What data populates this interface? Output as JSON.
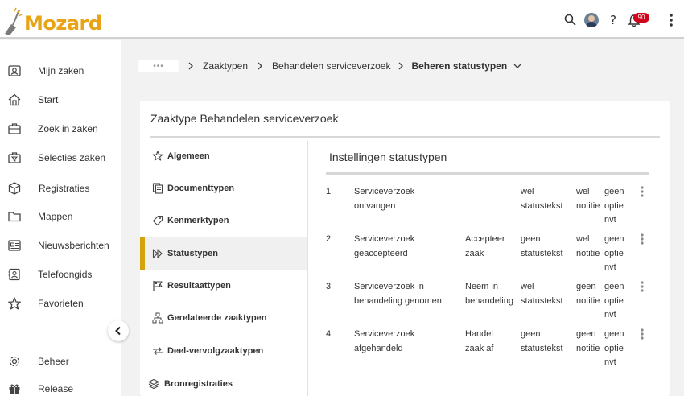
{
  "app": {
    "logo_text": "Mozard"
  },
  "topbar": {
    "notification_count": "90"
  },
  "sidebar": {
    "items": [
      {
        "label": "Mijn zaken",
        "icon": "user-card-icon"
      },
      {
        "label": "Start",
        "icon": "home-icon"
      },
      {
        "label": "Zoek in zaken",
        "icon": "briefcase-search-icon"
      },
      {
        "label": "Selecties zaken",
        "icon": "briefcase-filter-icon"
      },
      {
        "label": "Registraties",
        "icon": "cube-icon"
      },
      {
        "label": "Mappen",
        "icon": "folder-icon"
      },
      {
        "label": "Nieuwsberichten",
        "icon": "newspaper-icon"
      },
      {
        "label": "Telefoongids",
        "icon": "contacts-icon"
      },
      {
        "label": "Favorieten",
        "icon": "star-icon"
      },
      {
        "label": "Beheer",
        "icon": "gear-icon"
      },
      {
        "label": "Release",
        "icon": "gift-icon"
      }
    ]
  },
  "breadcrumb": {
    "dots": "•••",
    "items": [
      "Zaaktypen",
      "Behandelen serviceverzoek"
    ],
    "current": "Beheren statustypen"
  },
  "card": {
    "title": "Zaaktype Behandelen serviceverzoek"
  },
  "nav": {
    "items": [
      {
        "label": "Algemeen",
        "icon": "star-outline-icon"
      },
      {
        "label": "Documenttypen",
        "icon": "documents-icon"
      },
      {
        "label": "Kenmerktypen",
        "icon": "tag-icon"
      },
      {
        "label": "Statustypen",
        "icon": "step-forward-icon",
        "active": true
      },
      {
        "label": "Resultaattypen",
        "icon": "flag-icon"
      },
      {
        "label": "Gerelateerde zaaktypen",
        "icon": "hierarchy-icon"
      },
      {
        "label": "Deel-vervolgzaaktypen",
        "icon": "arrows-icon"
      },
      {
        "label": "Bronregistraties",
        "icon": "layers-icon"
      }
    ]
  },
  "section": {
    "title": "Instellingen statustypen",
    "rows": [
      {
        "num": "1",
        "name": [
          "Serviceverzoek",
          "ontvangen"
        ],
        "action": [
          "",
          ""
        ],
        "status": [
          "wel",
          "statustekst"
        ],
        "notitie": [
          "wel",
          "notitie"
        ],
        "optie": [
          "geen",
          "optie",
          "nvt"
        ]
      },
      {
        "num": "2",
        "name": [
          "Serviceverzoek",
          "geaccepteerd"
        ],
        "action": [
          "Accepteer",
          "zaak"
        ],
        "status": [
          "geen",
          "statustekst"
        ],
        "notitie": [
          "wel",
          "notitie"
        ],
        "optie": [
          "geen",
          "optie",
          "nvt"
        ]
      },
      {
        "num": "3",
        "name": [
          "Serviceverzoek in",
          "behandeling genomen"
        ],
        "action": [
          "Neem in",
          "behandeling"
        ],
        "status": [
          "wel",
          "statustekst"
        ],
        "notitie": [
          "geen",
          "notitie"
        ],
        "optie": [
          "geen",
          "optie",
          "nvt"
        ]
      },
      {
        "num": "4",
        "name": [
          "Serviceverzoek",
          "afgehandeld"
        ],
        "action": [
          "Handel",
          "zaak af"
        ],
        "status": [
          "geen",
          "statustekst"
        ],
        "notitie": [
          "geen",
          "notitie"
        ],
        "optie": [
          "geen",
          "optie",
          "nvt"
        ]
      }
    ]
  },
  "colors": {
    "accent": "#d4a20a",
    "logo": "#e8a317",
    "badge": "#d0021b"
  }
}
